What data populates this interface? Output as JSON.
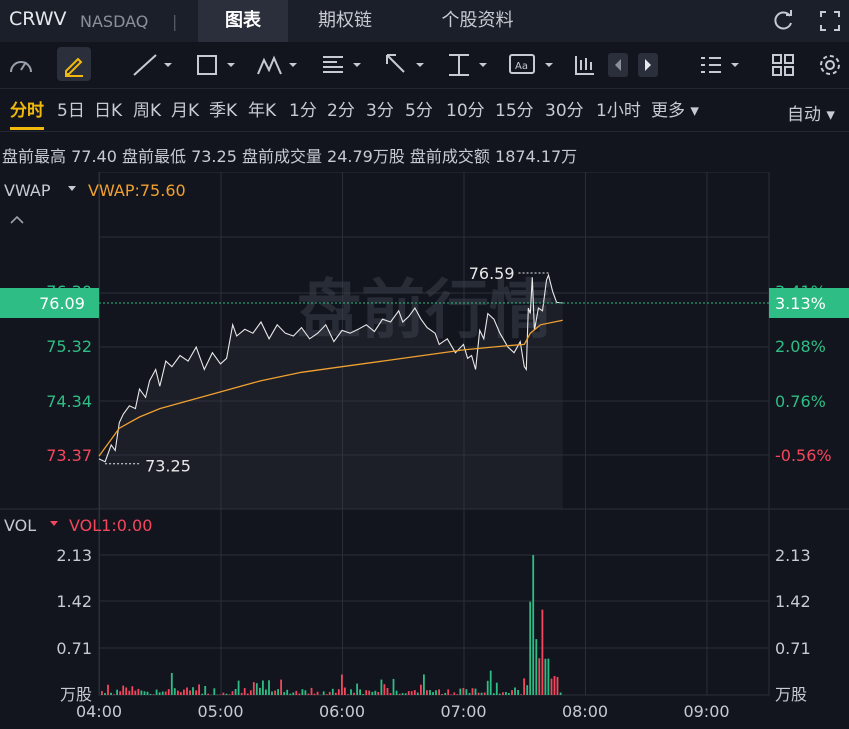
{
  "header": {
    "symbol": "CRWV",
    "exchange": "NASDAQ",
    "separator": "|",
    "tabs": [
      {
        "label": "图表"
      },
      {
        "label": "期权链"
      },
      {
        "label": "个股资料"
      }
    ]
  },
  "periods": [
    "分时",
    "5日",
    "日K",
    "周K",
    "月K",
    "季K",
    "年K",
    "1分",
    "2分",
    "3分",
    "5分",
    "10分",
    "15分",
    "30分",
    "1小时",
    "更多 ▾"
  ],
  "auto_label": "自动 ▾",
  "info_line": "盘前最高 77.40 盘前最低 73.25 盘前成交量 24.79万股 盘前成交额 1874.17万",
  "indicator": {
    "name": "VWAP",
    "value_label": "VWAP:75.60"
  },
  "watermark": "盘前行情",
  "price_axis": {
    "labels": [
      "76.09",
      "75.32",
      "74.34",
      "73.37"
    ],
    "pct_labels": [
      "3.13%",
      "2.08%",
      "0.76%",
      "-0.56%"
    ],
    "hidden_top": "76.30",
    "hidden_top_pct": "3.41%"
  },
  "current": {
    "price": "76.09",
    "pct": "3.13%"
  },
  "extremes": {
    "high": "76.59",
    "low": "73.25"
  },
  "vol": {
    "name": "VOL",
    "value_label": "VOL1:0.00",
    "labels": [
      "2.13",
      "1.42",
      "0.71"
    ],
    "unit": "万股"
  },
  "time_labels": [
    "04:00",
    "05:00",
    "06:00",
    "07:00",
    "08:00",
    "09:00"
  ],
  "colors": {
    "up": "#2ebd85",
    "down": "#f6465d",
    "vwap": "#f0a030",
    "accent": "#f0b90b",
    "price": "#e8e8e8"
  }
}
